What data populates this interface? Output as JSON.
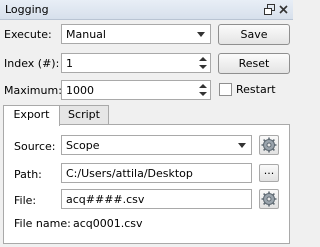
{
  "window": {
    "title": "Logging"
  },
  "execute": {
    "label": "Execute:",
    "value": "Manual",
    "save_label": "Save"
  },
  "index": {
    "label": "Index (#):",
    "value": "1",
    "reset_label": "Reset"
  },
  "maximum": {
    "label": "Maximum:",
    "value": "1000",
    "restart_label": "Restart",
    "restart_checked": false
  },
  "tabs": [
    {
      "label": "Export",
      "active": true
    },
    {
      "label": "Script",
      "active": false
    }
  ],
  "export": {
    "source_label": "Source:",
    "source_value": "Scope",
    "path_label": "Path:",
    "path_value": "C:/Users/attila/Desktop",
    "browse_label": "...",
    "file_label": "File:",
    "file_value": "acq####.csv",
    "filename_label": "File name:",
    "filename_value": "acq0001.csv"
  },
  "icons": {
    "float": "float-window-icon",
    "close": "close-icon",
    "config": "gear-icon"
  }
}
